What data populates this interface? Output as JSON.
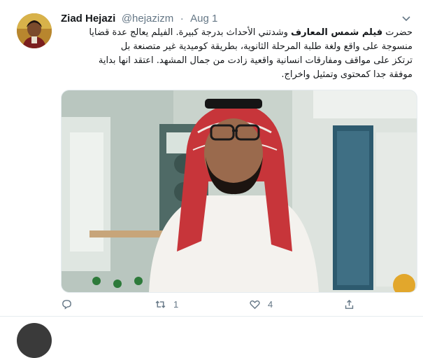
{
  "tweet": {
    "author_name": "Ziad Hejazi",
    "handle": "@hejazizm",
    "separator": "·",
    "date": "Aug 1",
    "text_lines": [
      {
        "before": "حضرت ",
        "bold": "فيلم شمس المعارف",
        "after": " وشدتني الأحداث بدرجة كبيرة. الفيلم يعالج عدة قضايا"
      },
      {
        "before": "منسوجة على واقع ولغة طلبة المرحلة الثانوية، بطريقة  كوميدية غير متصنعة بل",
        "bold": "",
        "after": ""
      },
      {
        "before": "ترتكز على مواقف ومفارقات انسانية واقعية زادت من جمال المشهد. اعتقد انها بداية",
        "bold": "",
        "after": ""
      },
      {
        "before": "موفقة جدا  كمحتوى وتمثيل واخراج.",
        "bold": "",
        "after": ""
      }
    ],
    "actions": {
      "reply_count": "",
      "retweet_count": "1",
      "like_count": "4"
    },
    "colors": {
      "secondary_text": "#657786",
      "divider": "#e6ecf0"
    },
    "icons": [
      "reply-icon",
      "retweet-icon",
      "like-icon",
      "share-icon",
      "caret-down-icon"
    ]
  }
}
